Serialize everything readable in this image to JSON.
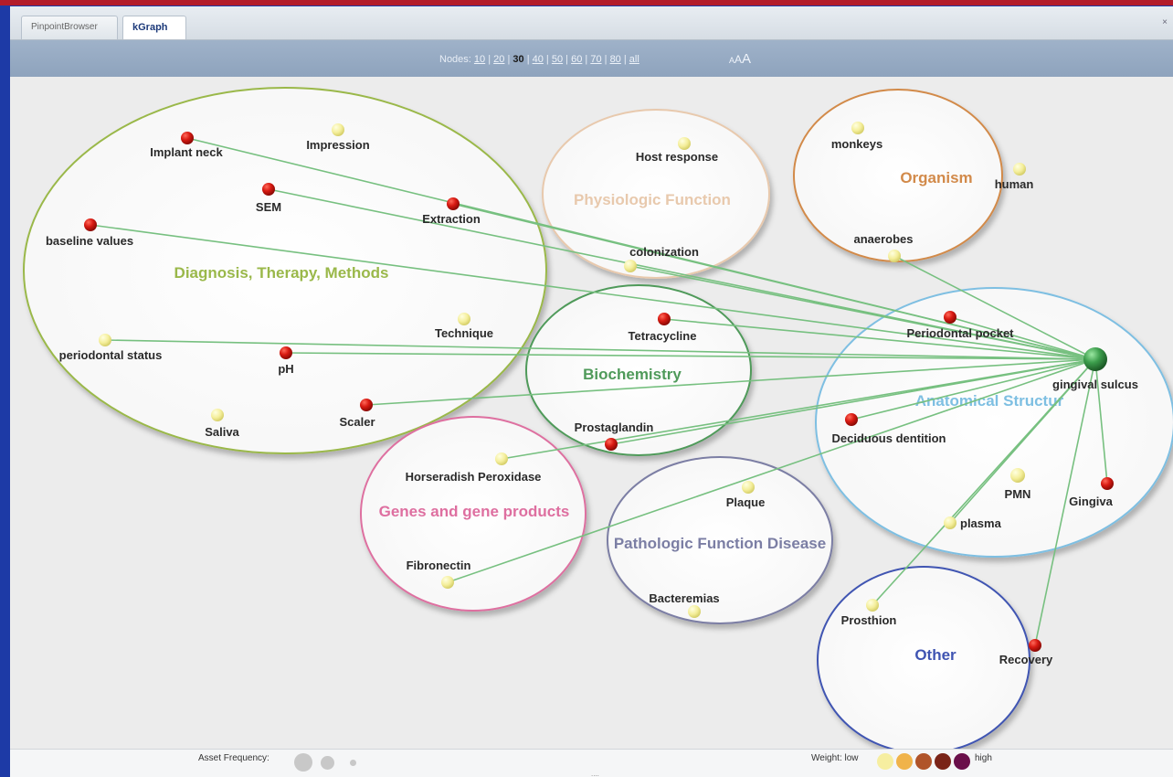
{
  "tabs": [
    {
      "label": "PinpointBrowser"
    },
    {
      "label": "kGraph"
    }
  ],
  "tab_close": "×",
  "nodes_bar": {
    "prefix": "Nodes:",
    "options": [
      "10",
      "20",
      "30",
      "40",
      "50",
      "60",
      "70",
      "80",
      "all"
    ],
    "selected": "30",
    "font_sizes": [
      "A",
      "A",
      "A"
    ]
  },
  "clusters": [
    {
      "id": "diag",
      "label": "Diagnosis, Therapy, Methods",
      "color": "#9ab84a"
    },
    {
      "id": "phys",
      "label": "Physiologic Function",
      "color": "#e8c9ad"
    },
    {
      "id": "org",
      "label": "Organism",
      "color": "#d28a4a"
    },
    {
      "id": "bio",
      "label": "Biochemistry",
      "color": "#4f9a5a"
    },
    {
      "id": "anat",
      "label": "Anatomical Structur",
      "color": "#7ebfe2"
    },
    {
      "id": "genes",
      "label": "Genes and gene products",
      "color": "#de6fa0"
    },
    {
      "id": "path",
      "label": "Pathologic Function Disease",
      "color": "#7b7ea4"
    },
    {
      "id": "other",
      "label": "Other",
      "color": "#3f54b2"
    }
  ],
  "graph_nodes": [
    {
      "id": "implant_neck",
      "label": "Implant neck",
      "weight": "high"
    },
    {
      "id": "impression",
      "label": "Impression",
      "weight": "low"
    },
    {
      "id": "sem",
      "label": "SEM",
      "weight": "high"
    },
    {
      "id": "extraction",
      "label": "Extraction",
      "weight": "high"
    },
    {
      "id": "baseline",
      "label": "baseline values",
      "weight": "high"
    },
    {
      "id": "technique",
      "label": "Technique",
      "weight": "low"
    },
    {
      "id": "periodontal_status",
      "label": "periodontal status",
      "weight": "low"
    },
    {
      "id": "ph",
      "label": "pH",
      "weight": "high"
    },
    {
      "id": "saliva",
      "label": "Saliva",
      "weight": "low"
    },
    {
      "id": "scaler",
      "label": "Scaler",
      "weight": "high"
    },
    {
      "id": "host_response",
      "label": "Host response",
      "weight": "low"
    },
    {
      "id": "colonization",
      "label": "colonization",
      "weight": "low"
    },
    {
      "id": "monkeys",
      "label": "monkeys",
      "weight": "low"
    },
    {
      "id": "human",
      "label": "human",
      "weight": "low"
    },
    {
      "id": "anaerobes",
      "label": "anaerobes",
      "weight": "low"
    },
    {
      "id": "tetracycline",
      "label": "Tetracycline",
      "weight": "high"
    },
    {
      "id": "prostaglandin",
      "label": "Prostaglandin",
      "weight": "high"
    },
    {
      "id": "periodontal_pocket",
      "label": "Periodontal pocket",
      "weight": "high"
    },
    {
      "id": "gingival_sulcus",
      "label": "gingival sulcus",
      "weight": "center"
    },
    {
      "id": "deciduous",
      "label": "Deciduous dentition",
      "weight": "high"
    },
    {
      "id": "pmn",
      "label": "PMN",
      "weight": "low"
    },
    {
      "id": "gingiva",
      "label": "Gingiva",
      "weight": "high"
    },
    {
      "id": "plasma",
      "label": "plasma",
      "weight": "low"
    },
    {
      "id": "horseradish",
      "label": "Horseradish Peroxidase",
      "weight": "low"
    },
    {
      "id": "fibronectin",
      "label": "Fibronectin",
      "weight": "low"
    },
    {
      "id": "plaque",
      "label": "Plaque",
      "weight": "low"
    },
    {
      "id": "bacteremias",
      "label": "Bacteremias",
      "weight": "low"
    },
    {
      "id": "prosthion",
      "label": "Prosthion",
      "weight": "low"
    },
    {
      "id": "recovery",
      "label": "Recovery",
      "weight": "high"
    }
  ],
  "footer": {
    "asset_frequency_label": "Asset Frequency:",
    "weight_label": "Weight: low",
    "weight_high": "high",
    "weight_colors": [
      "#f6eea0",
      "#f0b34a",
      "#b0542a",
      "#7a2418",
      "#6a0f4a"
    ]
  },
  "colors": {
    "high_node": "#cc1414",
    "low_node": "#f3ee9a",
    "center_node": "#3a9a4a",
    "edge": "#77c080"
  }
}
